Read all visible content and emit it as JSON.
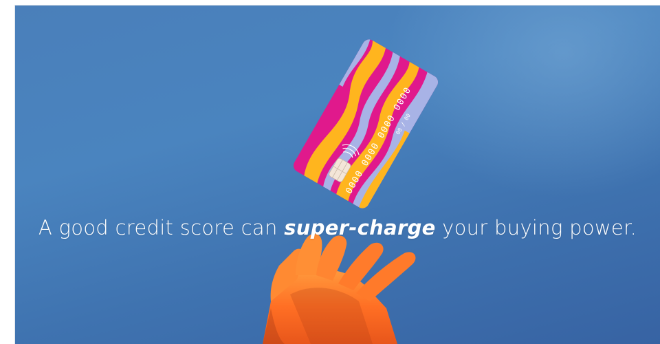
{
  "hero": {
    "headline_part1": "A good credit score can ",
    "headline_emphasis": "super-charge",
    "headline_part2": " your buying power."
  },
  "card": {
    "number_groups": [
      "0000",
      "0000",
      "0000",
      "0000"
    ],
    "expiry": "00 / 00"
  },
  "colors": {
    "background_top": "#4a84bf",
    "background_bottom": "#3763a3",
    "card_magenta": "#e0198c",
    "card_yellow": "#ffb51e",
    "card_lavender": "#a8b3e6",
    "hand": "#ff7a2a",
    "text": "#ffffff"
  },
  "icons": [
    "chip-icon",
    "contactless-icon",
    "hand-image"
  ]
}
